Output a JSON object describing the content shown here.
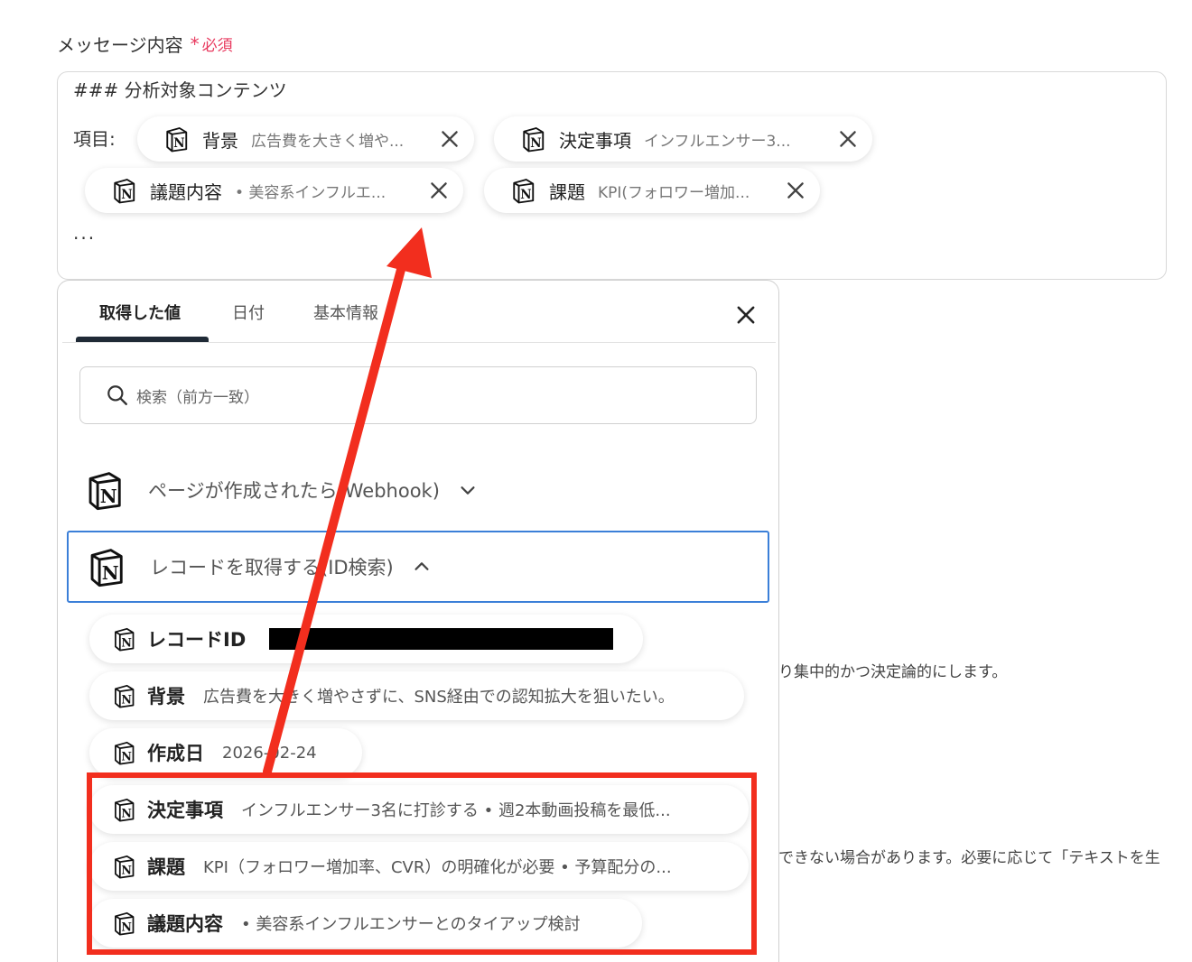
{
  "field": {
    "label": "メッセージ内容",
    "required_star": "*",
    "required_text": "必須"
  },
  "message": {
    "heading": "### 分析対象コンテンツ",
    "item_label": "項目:",
    "ellipsis": "...",
    "chips": [
      {
        "name": "背景",
        "value": "広告費を大きく増や..."
      },
      {
        "name": "決定事項",
        "value": "インフルエンサー3..."
      },
      {
        "name": "議題内容",
        "value": "• 美容系インフルエ..."
      },
      {
        "name": "課題",
        "value": "KPI(フォロワー増加..."
      }
    ]
  },
  "panel": {
    "tabs": [
      "取得した値",
      "日付",
      "基本情報"
    ],
    "active_tab": "取得した値",
    "search_placeholder": "検索（前方一致）",
    "groups": [
      {
        "label": "ページが作成されたら(Webhook)",
        "expanded": false
      },
      {
        "label": "レコードを取得する(ID検索)",
        "expanded": true
      }
    ],
    "values": [
      {
        "name": "レコードID",
        "value": ""
      },
      {
        "name": "背景",
        "value": "広告費を大きく増やさずに、SNS経由での認知拡大を狙いたい。"
      },
      {
        "name": "作成日",
        "value": "2026-02-24"
      },
      {
        "name": "決定事項",
        "value": "インフルエンサー3名に打診する • 週2本動画投稿を最低..."
      },
      {
        "name": "課題",
        "value": "KPI（フォロワー増加率、CVR）の明確化が必要 • 予算配分の..."
      },
      {
        "name": "議題内容",
        "value": "• 美容系インフルエンサーとのタイアップ検討"
      }
    ]
  },
  "background_text": {
    "line1": "り集中的かつ決定論的にします。",
    "line2": "できない場合があります。必要に応じて「テキストを生"
  },
  "colors": {
    "required": "#e83a5f",
    "annotation": "#f22e1e",
    "selected_border": "#3b7fd8"
  }
}
